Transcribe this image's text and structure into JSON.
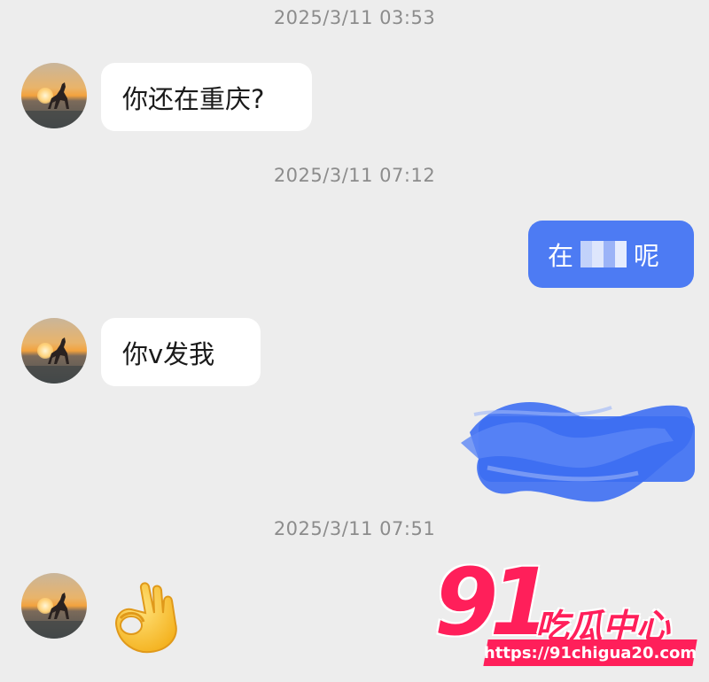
{
  "messages": {
    "timestamp_1": "2025/3/11 03:53",
    "incoming_1": "你还在重庆?",
    "timestamp_2": "2025/3/11 07:12",
    "outgoing_1_prefix": "在",
    "outgoing_1_suffix": "呢",
    "incoming_2": "你v发我",
    "timestamp_3": "2025/3/11 07:51",
    "incoming_3_emoji": "ok-hand-emoji"
  },
  "watermark": {
    "number": "91",
    "text": "吃瓜中心",
    "url": "https://91chigua20.com"
  },
  "colors": {
    "background": "#ededed",
    "incoming_bubble": "#ffffff",
    "outgoing_bubble": "#4d7bf3",
    "timestamp": "#8c8c8c",
    "watermark": "#ff1f5a"
  }
}
